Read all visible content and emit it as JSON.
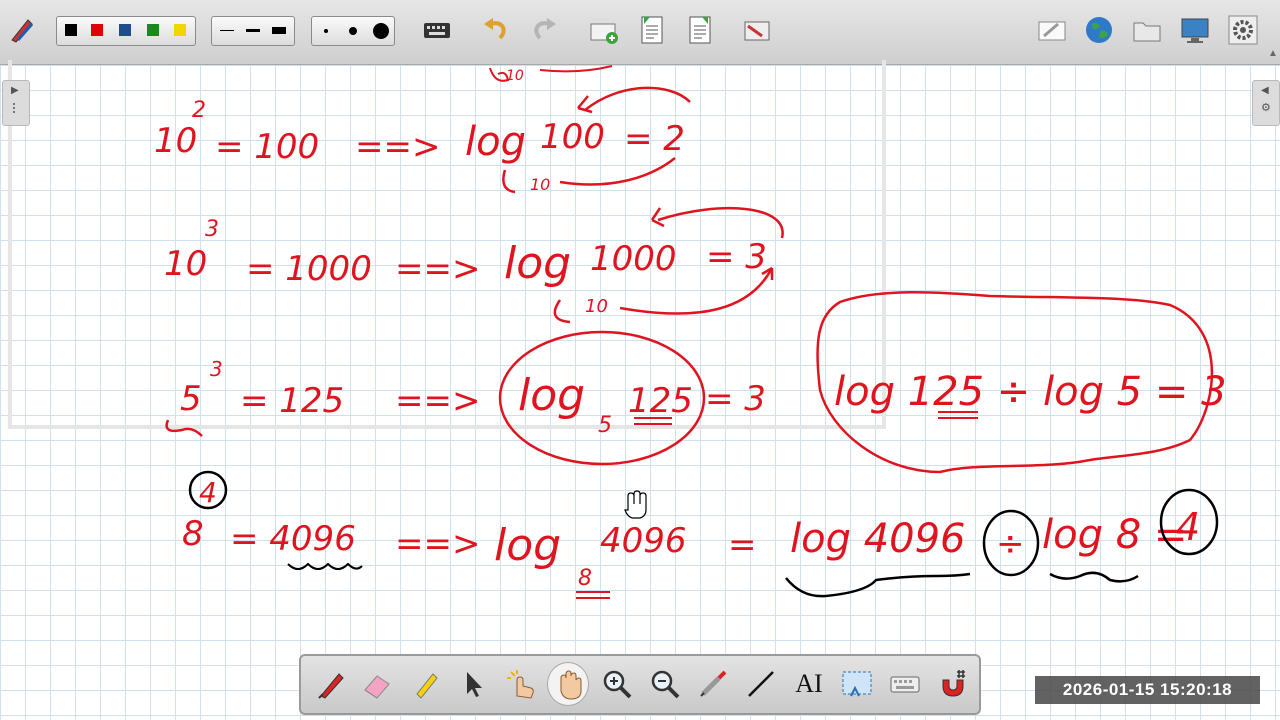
{
  "toolbar": {
    "pen_colors": [
      "#000000",
      "#e00000",
      "#1f4e8c",
      "#1a8a1a",
      "#f2d600"
    ],
    "line_widths": [
      "thin",
      "medium",
      "thick"
    ],
    "dot_sizes": [
      "small",
      "medium",
      "large"
    ],
    "icons_left": [
      "pen-settings-icon",
      "keyboard-icon",
      "undo-icon",
      "redo-icon",
      "new-page-icon",
      "prev-page-icon",
      "next-page-icon",
      "screenshot-icon"
    ],
    "icons_right": [
      "edit-page-icon",
      "globe-icon",
      "folder-icon",
      "display-icon",
      "settings-icon"
    ]
  },
  "palette": {
    "tools": [
      "pen-icon",
      "eraser-icon",
      "highlighter-icon",
      "pointer-icon",
      "touch-icon",
      "hand-icon",
      "zoom-in-icon",
      "zoom-out-icon",
      "syringe-icon",
      "line-icon",
      "text-tool-icon",
      "selection-capture-icon",
      "keyboard-icon",
      "magnet-icon"
    ],
    "text_tool_label": "AI",
    "active_tool": "hand-icon"
  },
  "timestamp": "2026-01-15  15:20:18",
  "whiteboard": {
    "ink_color": "#e0141e",
    "lines": [
      {
        "base": "10",
        "exponent": "2",
        "value": "= 100",
        "arrow": "==>",
        "log": "log",
        "log_base": "10",
        "argument": "100",
        "result": "= 2"
      },
      {
        "base": "10",
        "exponent": "3",
        "value": "= 1000",
        "arrow": "==>",
        "log": "log",
        "log_base": "10",
        "argument": "1000",
        "result": "= 3"
      },
      {
        "base": "5",
        "exponent": "3",
        "value": "= 125",
        "arrow": "==>",
        "log": "log",
        "log_base": "5",
        "argument": "125",
        "result": "= 3",
        "conversion": "log 125 ÷ log 5 = 3"
      },
      {
        "step_label": "4",
        "base": "8",
        "value": "= 4096",
        "arrow": "==>",
        "log": "log",
        "log_base": "8",
        "argument": "4096",
        "equals": "=",
        "left_log": "log 4096",
        "divide": "÷",
        "right_log": "log 8 =",
        "answer": "4"
      }
    ]
  }
}
